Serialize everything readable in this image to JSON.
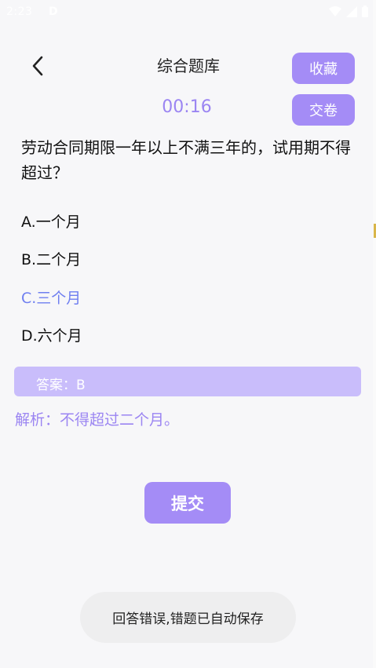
{
  "status_bar": {
    "time": "2:23",
    "extra_icon_letter": "D",
    "icons": [
      "wifi-icon",
      "cell-signal-icon",
      "battery-icon"
    ]
  },
  "header": {
    "title": "综合题库",
    "back_icon": "chevron-left-icon",
    "favorite_label": "收藏",
    "submit_paper_label": "交卷"
  },
  "timer": "00:16",
  "question": {
    "text": "劳动合同期限一年以上不满三年的，试用期不得超过？",
    "options": [
      {
        "label": "A.一个月",
        "selected": false
      },
      {
        "label": "B.二个月",
        "selected": false
      },
      {
        "label": "C.三个月",
        "selected": true
      },
      {
        "label": "D.六个月",
        "selected": false
      }
    ]
  },
  "answer": "答案：B",
  "analysis": "解析：不得超过二个月。",
  "submit_label": "提交",
  "toast": "回答错误,错题已自动保存",
  "colors": {
    "accent": "#a48cf6",
    "accent_light": "#c9bdfb",
    "selected_option": "#6f7ff0",
    "analysis_text": "#9b85f2",
    "background": "#f7f7f9"
  }
}
